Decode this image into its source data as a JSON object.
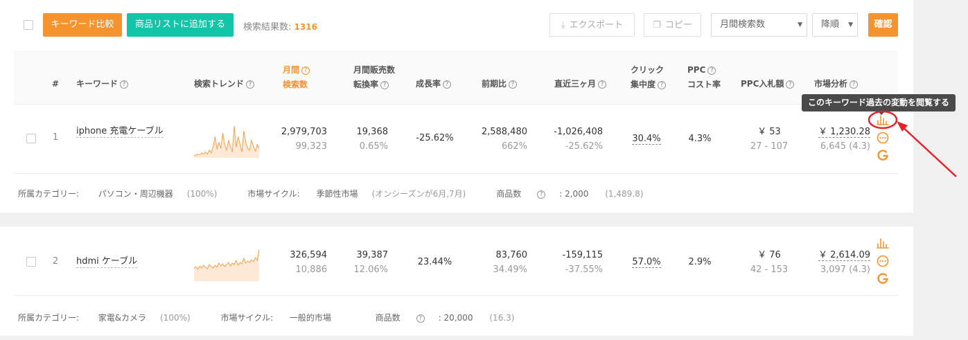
{
  "toolbar": {
    "compare_label": "キーワード比較",
    "add_label": "商品リストに追加する",
    "result_label": "検索結果数:",
    "result_count": "1316",
    "export_label": "エクスポート",
    "copy_label": "コピー",
    "sort_field": "月間検索数",
    "sort_order": "降順",
    "confirm_label": "確認"
  },
  "table": {
    "headers": {
      "num": "#",
      "keyword": "キーワード",
      "trend": "検索トレンド",
      "search_l1": "月間",
      "search_l2": "検索数",
      "sales_l1": "月間販売数",
      "sales_l2": "転換率",
      "growth": "成長率",
      "prev": "前期比",
      "three": "直近三ヶ月",
      "click_l1": "クリック",
      "click_l2": "集中度",
      "ppc_l1": "PPC",
      "ppc_l2": "コスト率",
      "bid": "PPC入札額",
      "market": "市場分析"
    },
    "rows": [
      {
        "num": "1",
        "keyword": "iphone 充電ケーブル",
        "search": "2,979,703",
        "search_sub": "99,323",
        "sales": "19,368",
        "sales_sub": "0.65%",
        "growth": "-25.62%",
        "prev": "2,588,480",
        "prev_sub": "662%",
        "three": "-1,026,408",
        "three_sub": "-25.62%",
        "click": "30.4%",
        "ppc": "4.3%",
        "bid": "￥ 53",
        "bid_sub": "27 - 107",
        "market": "￥ 1,230.28",
        "market_sub": "6,645 (4.3)",
        "trend": [
          2,
          3,
          4,
          3,
          5,
          4,
          6,
          4,
          8,
          5,
          12,
          22,
          9,
          16,
          10,
          26,
          14,
          8,
          18,
          12,
          6,
          33,
          11,
          22,
          14,
          6,
          28,
          16,
          10,
          8,
          18,
          12,
          7,
          14,
          10
        ],
        "meta_category_label": "所属カテゴリー:",
        "meta_category": "パソコン・周辺機器",
        "meta_category_pct": "(100%)",
        "meta_cycle_label": "市場サイクル:",
        "meta_cycle": "季節性市場",
        "meta_cycle_note": "(オンシーズンが6月,7月)",
        "meta_products_label": "商品数",
        "meta_products": "2,000",
        "meta_products_note": "(1,489.8)"
      },
      {
        "num": "2",
        "keyword": "hdmi ケーブル",
        "search": "326,594",
        "search_sub": "10,886",
        "sales": "39,387",
        "sales_sub": "12.06%",
        "growth": "23.44%",
        "prev": "83,760",
        "prev_sub": "34.49%",
        "three": "-159,115",
        "three_sub": "-37.55%",
        "click": "57.0%",
        "ppc": "2.9%",
        "bid": "￥ 76",
        "bid_sub": "42 - 153",
        "market": "￥ 2,614.09",
        "market_sub": "3,097 (4.3)",
        "trend": [
          18,
          21,
          17,
          22,
          19,
          23,
          20,
          18,
          24,
          21,
          19,
          23,
          20,
          26,
          22,
          25,
          21,
          24,
          27,
          22,
          26,
          24,
          30,
          23,
          27,
          25,
          33,
          26,
          29,
          27,
          31,
          28,
          34,
          30,
          46
        ],
        "meta_category_label": "所属カテゴリー:",
        "meta_category": "家電&カメラ",
        "meta_category_pct": "(100%)",
        "meta_cycle_label": "市場サイクル:",
        "meta_cycle": "一般的市場",
        "meta_cycle_note": "",
        "meta_products_label": "商品数",
        "meta_products": "20,000",
        "meta_products_note": "(16.3)"
      }
    ]
  },
  "tooltip": "このキーワード過去の変動を閲覧する",
  "colors": {
    "accent": "#f5932f",
    "green": "#13c5a8",
    "annotation": "#e8202a"
  }
}
